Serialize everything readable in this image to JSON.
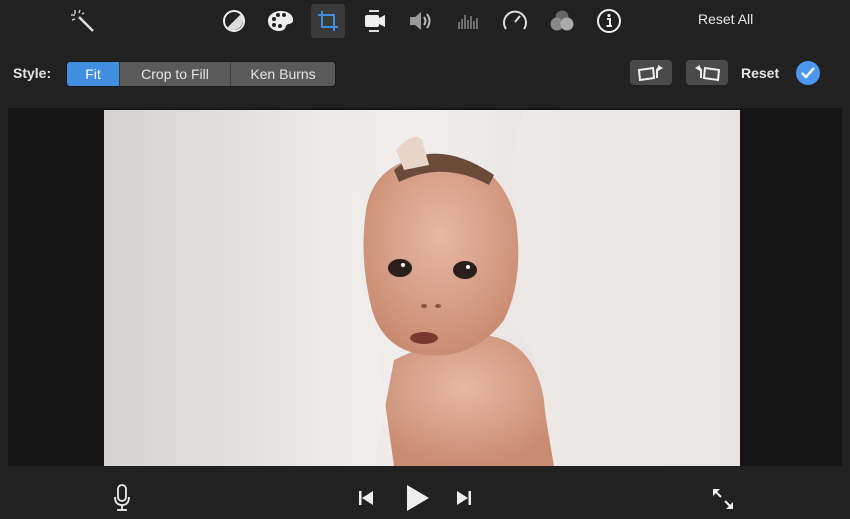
{
  "toolbar": {
    "tools": [
      {
        "name": "magic-wand-icon",
        "label": "Enhance"
      },
      {
        "name": "color-balance-icon",
        "label": "Color balance"
      },
      {
        "name": "color-correction-icon",
        "label": "Color correction"
      },
      {
        "name": "crop-icon",
        "label": "Cropping",
        "active": true
      },
      {
        "name": "stabilization-icon",
        "label": "Stabilization"
      },
      {
        "name": "volume-icon",
        "label": "Volume"
      },
      {
        "name": "noise-reduction-icon",
        "label": "Noise reduction and equalizer"
      },
      {
        "name": "speed-icon",
        "label": "Speed"
      },
      {
        "name": "clip-filter-icon",
        "label": "Clip filter and audio effects"
      },
      {
        "name": "info-icon",
        "label": "Clip information"
      }
    ],
    "reset_all_label": "Reset All"
  },
  "crop_bar": {
    "style_label": "Style:",
    "style_options": [
      "Fit",
      "Crop to Fill",
      "Ken Burns"
    ],
    "selected_style": "Fit",
    "reset_label": "Reset",
    "colors": {
      "accent": "#3f8ee0",
      "check": "#4d97f0"
    }
  },
  "viewer": {
    "image_description": "Baby peeking out from white sheet"
  },
  "playback": {
    "controls": [
      "microphone",
      "previous",
      "play",
      "next",
      "fullscreen"
    ]
  }
}
